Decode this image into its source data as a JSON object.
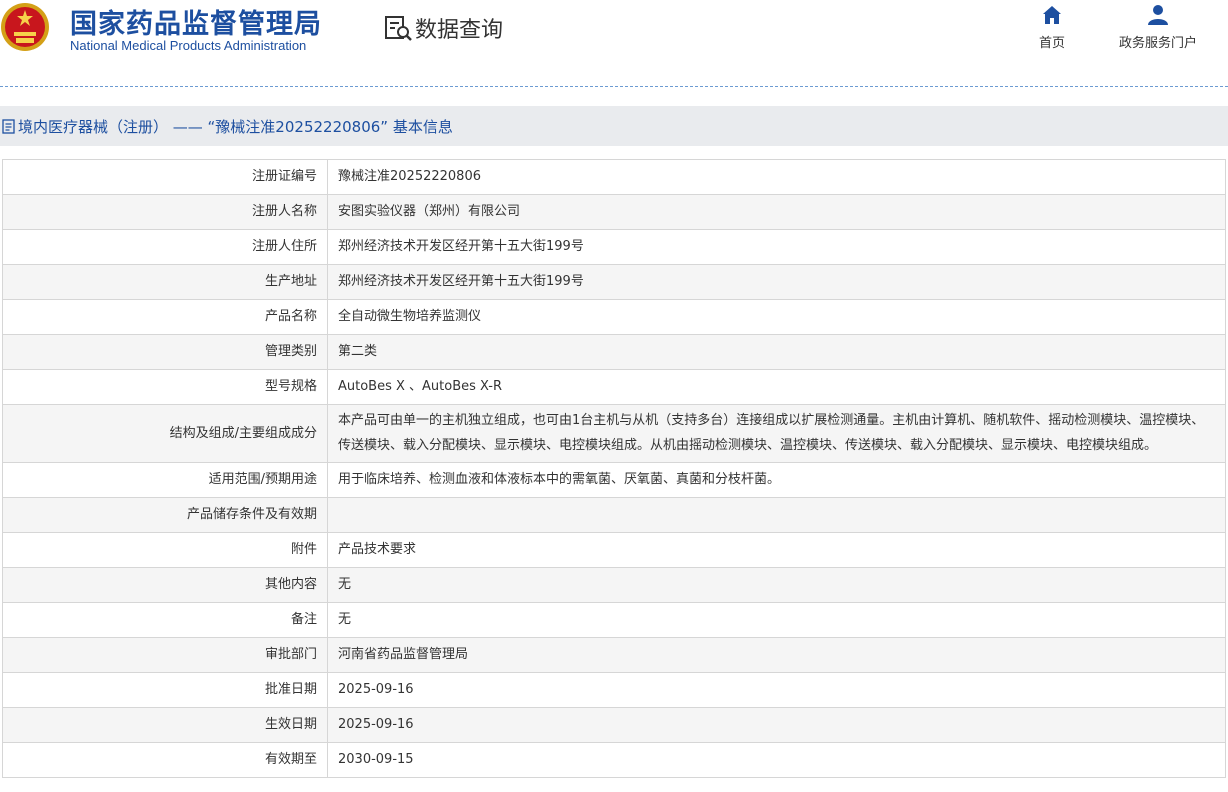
{
  "header": {
    "title_cn": "国家药品监督管理局",
    "title_en": "National Medical Products Administration",
    "data_query": "数据查询",
    "nav": [
      {
        "label": "首页",
        "icon": "home-icon"
      },
      {
        "label": "政务服务门户",
        "icon": "user-icon"
      }
    ]
  },
  "colors": {
    "brand": "#1d4fa0",
    "bar_bg": "#e9ebee",
    "row_alt": "#f5f5f5",
    "border": "#d6d6d6"
  },
  "breadcrumb": "境内医疗器械（注册） —— “豫械注准20252220806” 基本信息",
  "rows": [
    {
      "label": "注册证编号",
      "value": "豫械注准20252220806"
    },
    {
      "label": "注册人名称",
      "value": "安图实验仪器（郑州）有限公司"
    },
    {
      "label": "注册人住所",
      "value": "郑州经济技术开发区经开第十五大街199号"
    },
    {
      "label": "生产地址",
      "value": "郑州经济技术开发区经开第十五大街199号"
    },
    {
      "label": "产品名称",
      "value": "全自动微生物培养监测仪"
    },
    {
      "label": "管理类别",
      "value": "第二类"
    },
    {
      "label": "型号规格",
      "value": "AutoBes X 、AutoBes X-R"
    },
    {
      "label": "结构及组成/主要组成成分",
      "value": "本产品可由单一的主机独立组成，也可由1台主机与从机（支持多台）连接组成以扩展检测通量。主机由计算机、随机软件、摇动检测模块、温控模块、传送模块、载入分配模块、显示模块、电控模块组成。从机由摇动检测模块、温控模块、传送模块、载入分配模块、显示模块、电控模块组成。"
    },
    {
      "label": "适用范围/预期用途",
      "value": "用于临床培养、检测血液和体液标本中的需氧菌、厌氧菌、真菌和分枝杆菌。"
    },
    {
      "label": "产品储存条件及有效期",
      "value": ""
    },
    {
      "label": "附件",
      "value": "产品技术要求"
    },
    {
      "label": "其他内容",
      "value": "无"
    },
    {
      "label": "备注",
      "value": "无"
    },
    {
      "label": "审批部门",
      "value": "河南省药品监督管理局"
    },
    {
      "label": "批准日期",
      "value": "2025-09-16"
    },
    {
      "label": "生效日期",
      "value": "2025-09-16"
    },
    {
      "label": "有效期至",
      "value": "2030-09-15"
    }
  ]
}
